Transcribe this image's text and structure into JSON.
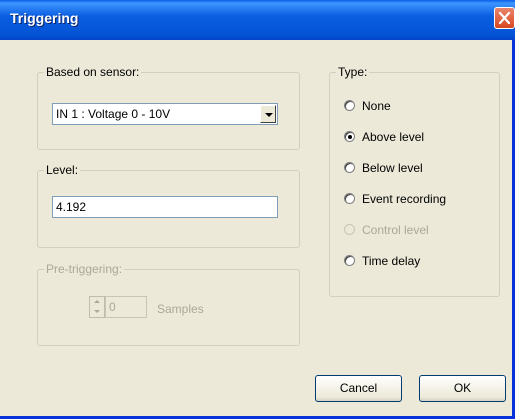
{
  "window": {
    "title": "Triggering"
  },
  "sensor_group": {
    "legend": "Based on sensor:",
    "selected": "IN 1 : Voltage 0 - 10V"
  },
  "level_group": {
    "legend": "Level:",
    "value": "4.192"
  },
  "pretrigger_group": {
    "legend": "Pre-triggering:",
    "value": "0",
    "unit": "Samples",
    "enabled": false
  },
  "type_group": {
    "legend": "Type:",
    "options": [
      {
        "label": "None",
        "checked": false,
        "enabled": true
      },
      {
        "label": "Above level",
        "checked": true,
        "enabled": true
      },
      {
        "label": "Below level",
        "checked": false,
        "enabled": true
      },
      {
        "label": "Event recording",
        "checked": false,
        "enabled": true
      },
      {
        "label": "Control level",
        "checked": false,
        "enabled": false
      },
      {
        "label": "Time delay",
        "checked": false,
        "enabled": true
      }
    ]
  },
  "buttons": {
    "cancel": "Cancel",
    "ok": "OK"
  },
  "colors": {
    "titlebar": "#0a5ee0",
    "close": "#d8461f",
    "dialog_bg": "#ece9d8"
  }
}
